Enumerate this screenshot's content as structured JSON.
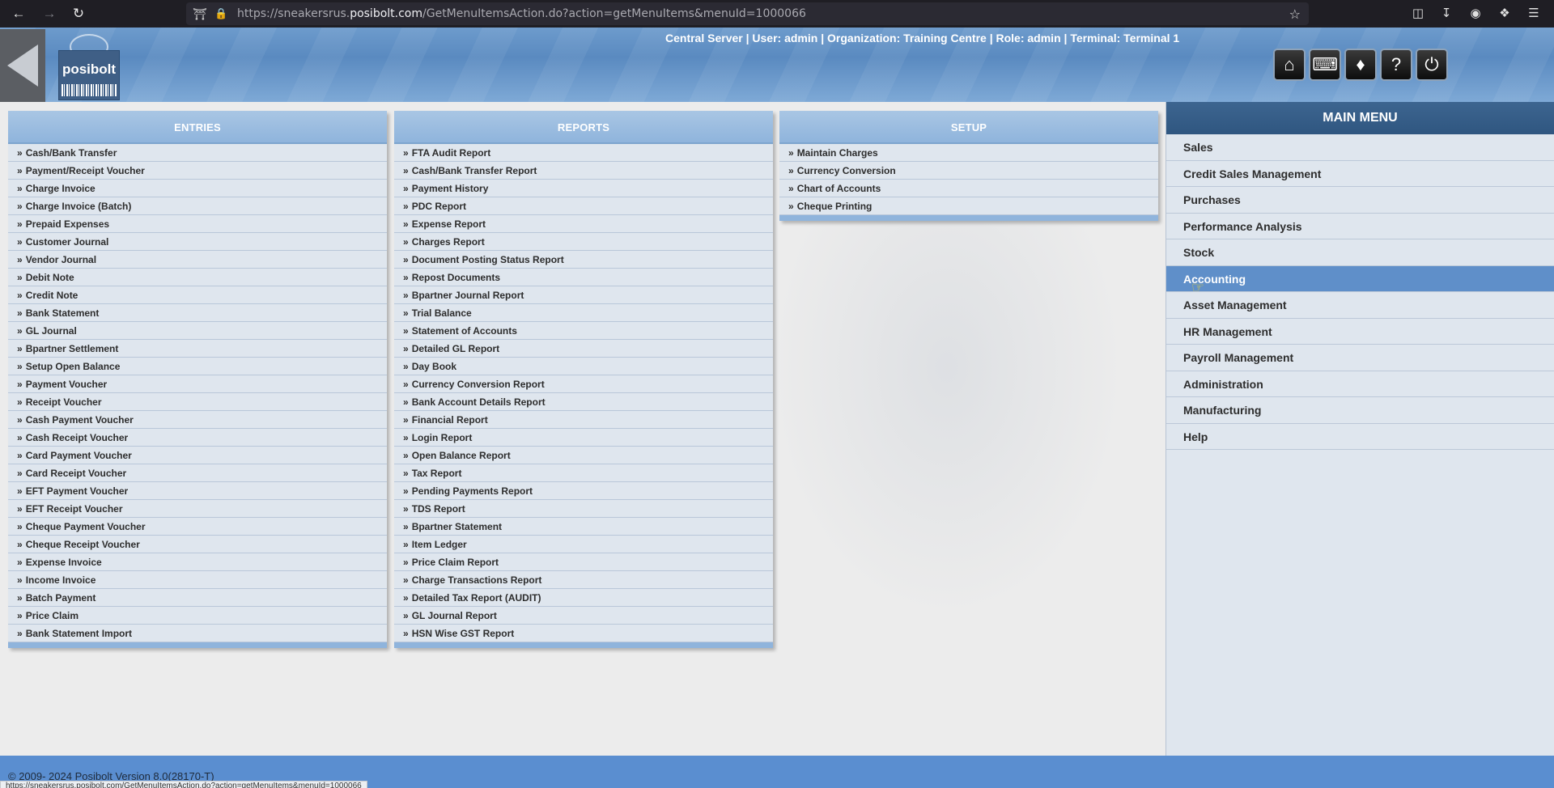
{
  "browser": {
    "url_prefix": "https://sneakersrus.",
    "url_domain": "posibolt.com",
    "url_suffix": "/GetMenuItemsAction.do?action=getMenuItems&menuId=1000066",
    "status_url": "https://sneakersrus.posibolt.com/GetMenuItemsAction.do?action=getMenuItems&menuId=1000066"
  },
  "header": {
    "logo_text": "posibolt",
    "status": "Central Server | User: admin | Organization: Training Centre | Role: admin | Terminal: Terminal 1",
    "buttons": [
      "home-icon",
      "keyboard-icon",
      "handshake-icon",
      "help-icon",
      "power-icon"
    ]
  },
  "entries": {
    "title": "ENTRIES",
    "items": [
      "Cash/Bank Transfer",
      "Payment/Receipt Voucher",
      "Charge Invoice",
      "Charge Invoice (Batch)",
      "Prepaid Expenses",
      "Customer Journal",
      "Vendor Journal",
      "Debit Note",
      "Credit Note",
      "Bank Statement",
      "GL Journal",
      "Bpartner Settlement",
      "Setup Open Balance",
      "Payment Voucher",
      "Receipt Voucher",
      "Cash Payment Voucher",
      "Cash Receipt Voucher",
      "Card Payment Voucher",
      "Card Receipt Voucher",
      "EFT Payment Voucher",
      "EFT Receipt Voucher",
      "Cheque Payment Voucher",
      "Cheque Receipt Voucher",
      "Expense Invoice",
      "Income Invoice",
      "Batch Payment",
      "Price Claim",
      "Bank Statement Import"
    ]
  },
  "reports": {
    "title": "REPORTS",
    "items": [
      "FTA Audit Report",
      "Cash/Bank Transfer Report",
      "Payment History",
      "PDC Report",
      "Expense Report",
      "Charges Report",
      "Document Posting Status Report",
      "Repost Documents",
      "Bpartner Journal Report",
      "Trial Balance",
      "Statement of Accounts",
      "Detailed GL Report",
      "Day Book",
      "Currency Conversion Report",
      "Bank Account Details Report",
      "Financial Report",
      "Login Report",
      "Open Balance Report",
      "Tax Report",
      "Pending Payments Report",
      "TDS Report",
      "Bpartner Statement",
      "Item Ledger",
      "Price Claim Report",
      "Charge Transactions Report",
      "Detailed Tax Report (AUDIT)",
      "GL Journal Report",
      "HSN Wise GST Report"
    ]
  },
  "setup": {
    "title": "SETUP",
    "items": [
      "Maintain Charges",
      "Currency Conversion",
      "Chart of Accounts",
      "Cheque Printing"
    ]
  },
  "main_menu": {
    "title": "MAIN MENU",
    "items": [
      "Sales",
      "Credit Sales Management",
      "Purchases",
      "Performance Analysis",
      "Stock",
      "Accounting",
      "Asset Management",
      "HR Management",
      "Payroll Management",
      "Administration",
      "Manufacturing",
      "Help"
    ],
    "active": "Accounting"
  },
  "footer": {
    "text": "© 2009- 2024 Posibolt Version  8.0(28170-T)"
  }
}
